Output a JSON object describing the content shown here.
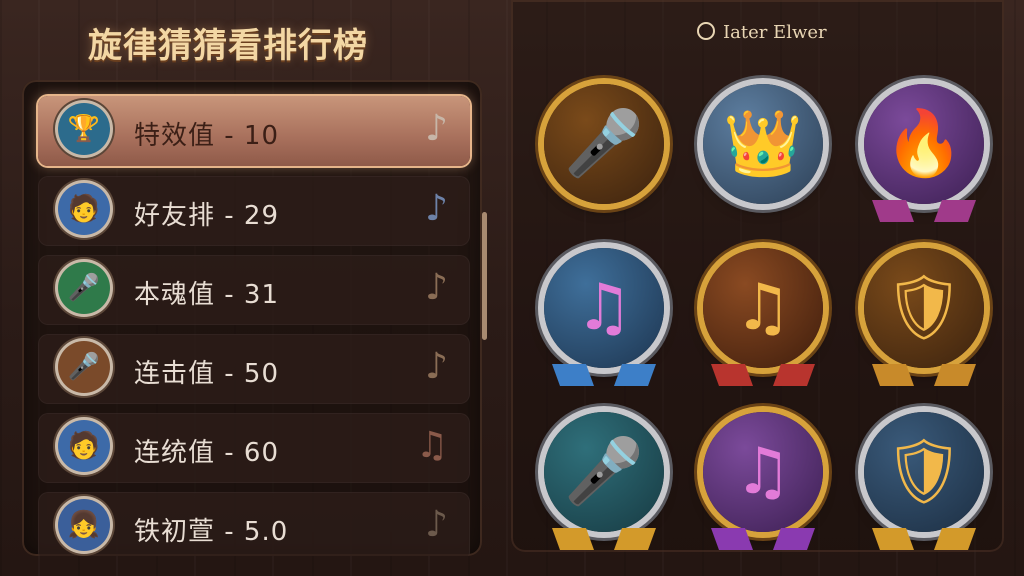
{
  "title": "旋律猜猜看排行榜",
  "timer": {
    "text": "Iater Elwer"
  },
  "leaderboard": [
    {
      "label": "特效值 - 10",
      "avatar_icon": "trophy-icon",
      "selected": true,
      "note_color": "#c7b6a8"
    },
    {
      "label": "好友排 - 29",
      "avatar_icon": "boy-avatar",
      "selected": false,
      "note_color": "#6d82a8"
    },
    {
      "label": "本魂值 - 31",
      "avatar_icon": "microphone-trophy-icon",
      "selected": false,
      "note_color": "#8a6d55"
    },
    {
      "label": "连击值 - 50",
      "avatar_icon": "microphone-icon",
      "selected": false,
      "note_color": "#8a6d55"
    },
    {
      "label": "连统值 - 60",
      "avatar_icon": "boy-avatar",
      "selected": false,
      "note_color": "#8a5a4a"
    },
    {
      "label": "铁初萱 - 5.0",
      "avatar_icon": "girl-avatar",
      "selected": false,
      "note_color": "#6c5a4c"
    }
  ],
  "badges": [
    {
      "name": "microphone-gold-badge",
      "icon": "microphone-icon",
      "color": "#f2b84a",
      "ring": "gold"
    },
    {
      "name": "crown-badge",
      "icon": "crown-icon",
      "color": "#f2b84a",
      "ring": "silver"
    },
    {
      "name": "fire-badge",
      "icon": "fire-icon",
      "color": "#ff7a2e",
      "ring": "silver"
    },
    {
      "name": "music-note-badge",
      "icon": "music-note-icon",
      "color": "#c75cd8",
      "ring": "silver"
    },
    {
      "name": "star-note-badge",
      "icon": "star-note-icon",
      "color": "#f2b84a",
      "ring": "gold"
    },
    {
      "name": "star-shield-badge",
      "icon": "star-shield-icon",
      "color": "#f2b84a",
      "ring": "gold"
    },
    {
      "name": "microphone-blue-badge",
      "icon": "microphone-icon",
      "color": "#f2b84a",
      "ring": "silver"
    },
    {
      "name": "purple-note-badge",
      "icon": "music-note-icon",
      "color": "#c75cd8",
      "ring": "gold"
    },
    {
      "name": "shield-badge",
      "icon": "star-shield-icon",
      "color": "#f2b84a",
      "ring": "silver"
    }
  ]
}
